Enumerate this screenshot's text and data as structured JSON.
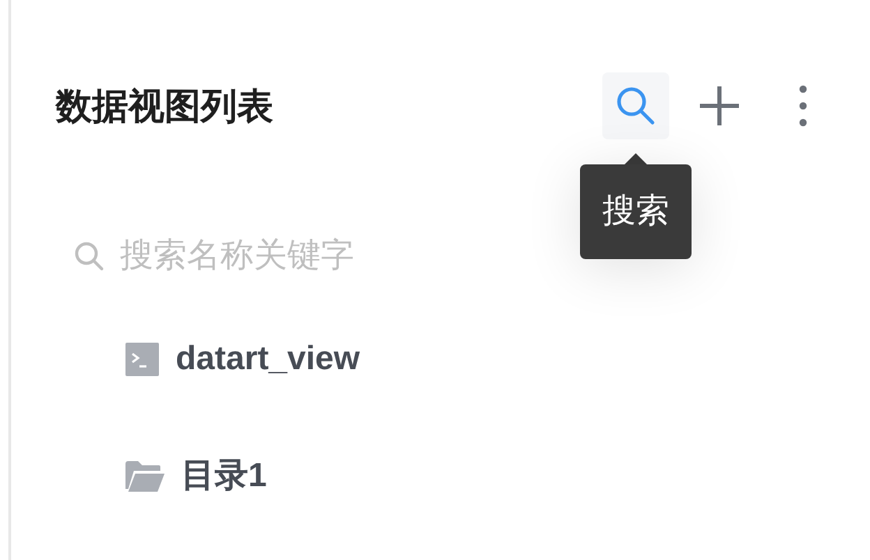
{
  "panel": {
    "title": "数据视图列表"
  },
  "toolbar": [
    {
      "kind": "search",
      "highlighted": true,
      "tooltip": "搜索"
    },
    {
      "kind": "add",
      "highlighted": false
    },
    {
      "kind": "more",
      "highlighted": false
    }
  ],
  "search": {
    "placeholder": "搜索名称关键字"
  },
  "tree": [
    {
      "kind": "view",
      "label": "datart_view"
    },
    {
      "kind": "folder",
      "label": "目录1"
    }
  ]
}
